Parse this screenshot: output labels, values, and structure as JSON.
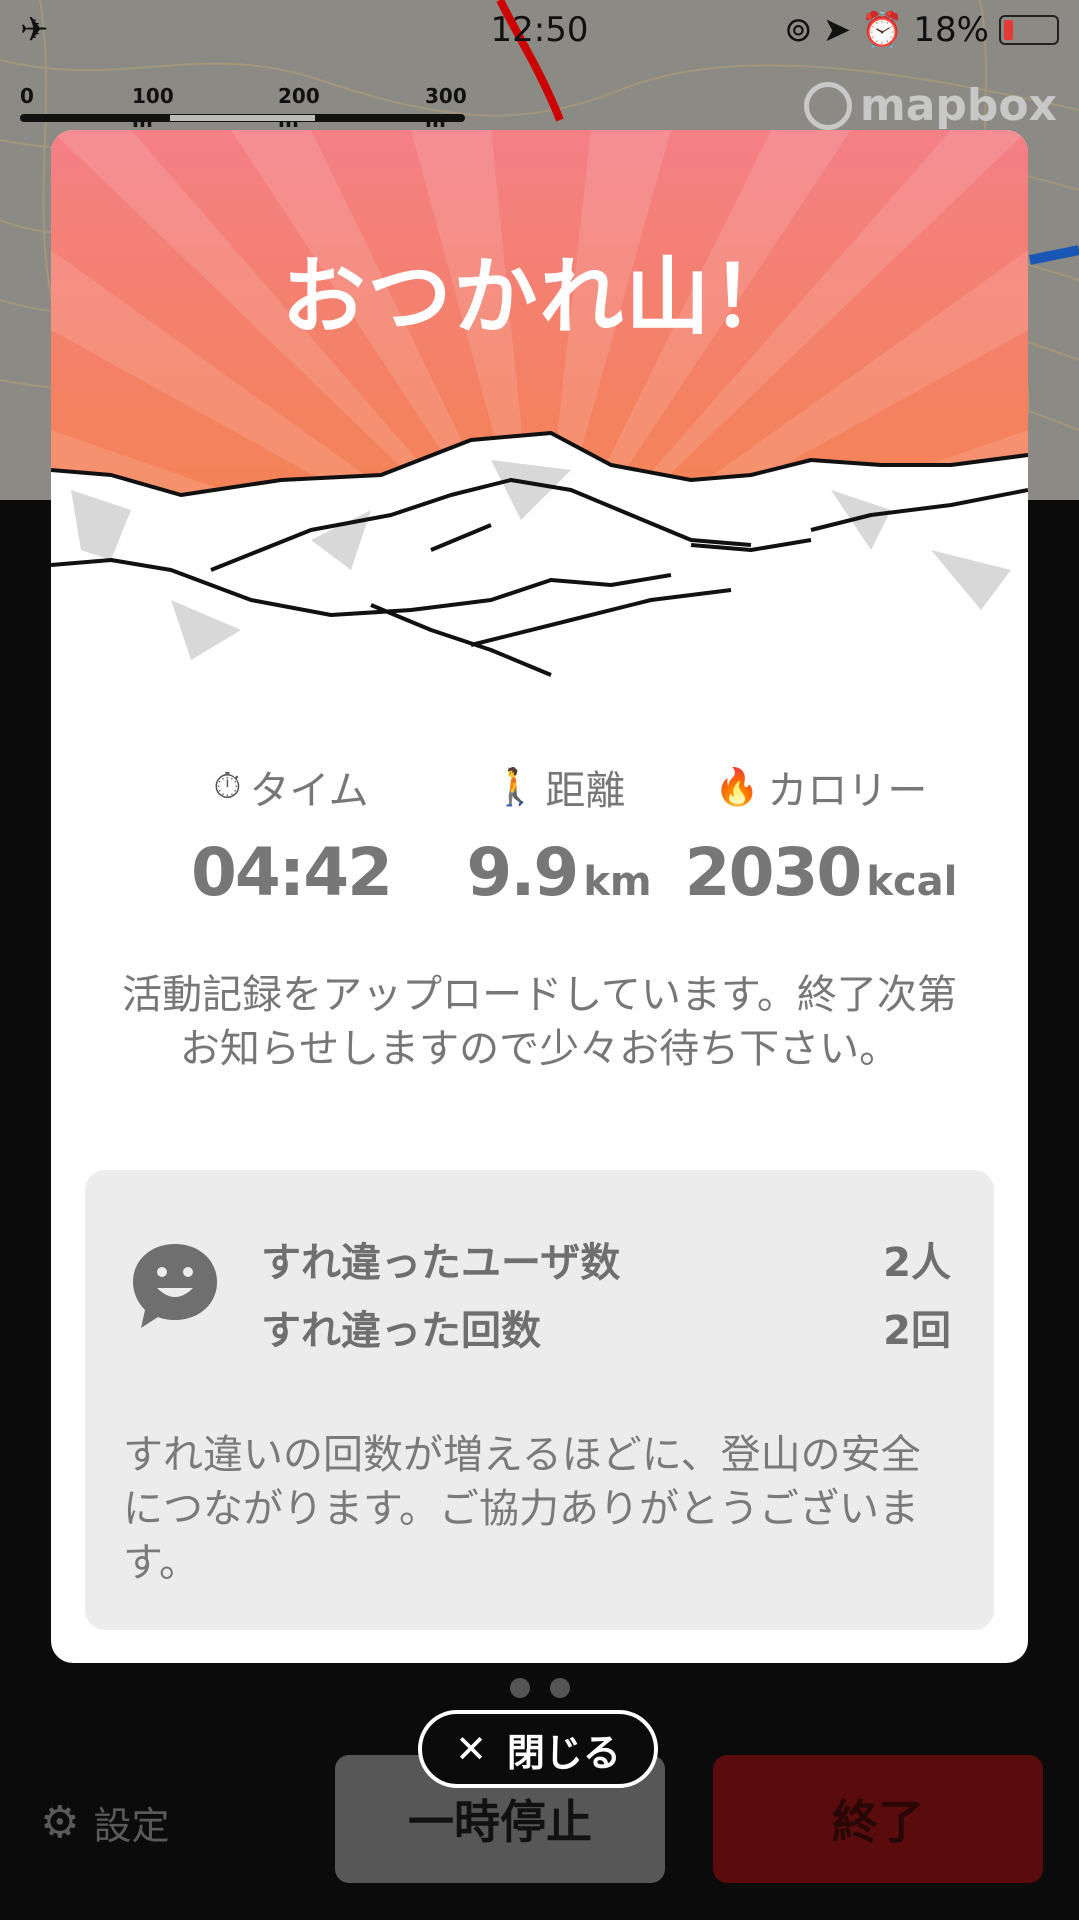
{
  "status_bar": {
    "time": "12:50",
    "battery": "18%"
  },
  "map": {
    "scale_labels": [
      "0",
      "100 m",
      "200 m",
      "300 m"
    ],
    "attribution": "mapbox"
  },
  "modal": {
    "headline": "おつかれ山！",
    "stats": {
      "time": {
        "label": "タイム",
        "value": "04:42"
      },
      "distance": {
        "label": "距離",
        "value": "9.9",
        "unit": "km"
      },
      "calories": {
        "label": "カロリー",
        "value": "2030",
        "unit": "kcal"
      }
    },
    "upload_message": "活動記録をアップロードしています。終了次第お知らせしますので少々お待ち下さい。",
    "passing": {
      "users_label": "すれ違ったユーザ数",
      "users_value": "2人",
      "count_label": "すれ違った回数",
      "count_value": "2回",
      "note": "すれ違いの回数が増えるほどに、登山の安全につながります。ご協力ありがとうございます。"
    }
  },
  "close_label": "閉じる",
  "bottom": {
    "settings_label": "設定",
    "pause_label": "一時停止",
    "end_label": "終了"
  },
  "colors": {
    "banner_top": "#f27a80",
    "banner_bottom": "#f4893f",
    "end_button": "#5a0c0c"
  }
}
